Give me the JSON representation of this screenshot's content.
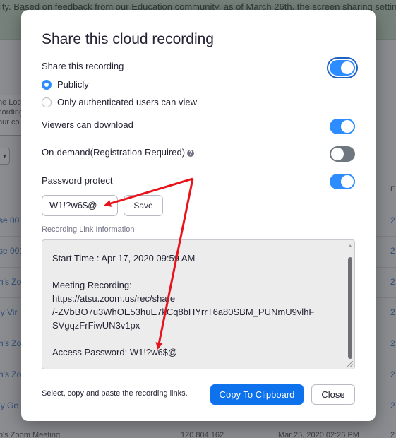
{
  "background": {
    "banner_text": "ity. Based on feedback from our Education community, as of March 26th, the screen sharing settings wi",
    "side_box_lines": [
      "he Loca",
      "cording",
      "our co"
    ],
    "side_select": "▾",
    "column_header": "F",
    "rows": [
      {
        "title": "se 001",
        "link": "2"
      },
      {
        "title": "se 001",
        "link": "2"
      },
      {
        "title": "n's Zo",
        "link": "2"
      },
      {
        "title": "ly Vir",
        "link": "2"
      },
      {
        "title": "n's Zo",
        "link": "2"
      },
      {
        "title": "n's Zo",
        "link": "2"
      },
      {
        "title": "ly Ge",
        "link": "2"
      }
    ],
    "bottom_row": {
      "title": "n's Zoom Meeting",
      "id": "120 804 162",
      "date": "Mar 25, 2020 02:26 PM",
      "link": "2"
    }
  },
  "modal": {
    "title": "Share this cloud recording",
    "share_label": "Share this recording",
    "share_enabled": true,
    "visibility_options": [
      {
        "label": "Publicly",
        "selected": true
      },
      {
        "label": "Only authenticated users can view",
        "selected": false
      }
    ],
    "download_label": "Viewers can download",
    "download_enabled": true,
    "on_demand_label": "On-demand(Registration Required)",
    "on_demand_enabled": false,
    "on_demand_help_icon": "question-mark-icon",
    "password_label": "Password protect",
    "password_enabled": true,
    "password_value": "W1!?w6$@",
    "save_label": "Save",
    "link_info_label": "Recording Link Information",
    "link_info_text": "Start Time : Apr 17, 2020 09:59 AM\n\nMeeting Recording:\nhttps://atsu.zoom.us/rec/share\n/-ZVbBO7u3WhOE53huE7kCq8bHYrrT6a80SBM_PUNmU9vlhF\nSVgqzFrFiwUN3v1px\n\nAccess Password: W1!?w6$@",
    "footer_hint": "Select, copy and paste the recording links.",
    "copy_label": "Copy To Clipboard",
    "close_label": "Close"
  },
  "colors": {
    "accent": "#2d8cff",
    "primary_button": "#0e72ed",
    "annotation_arrows": "#e8141c"
  }
}
